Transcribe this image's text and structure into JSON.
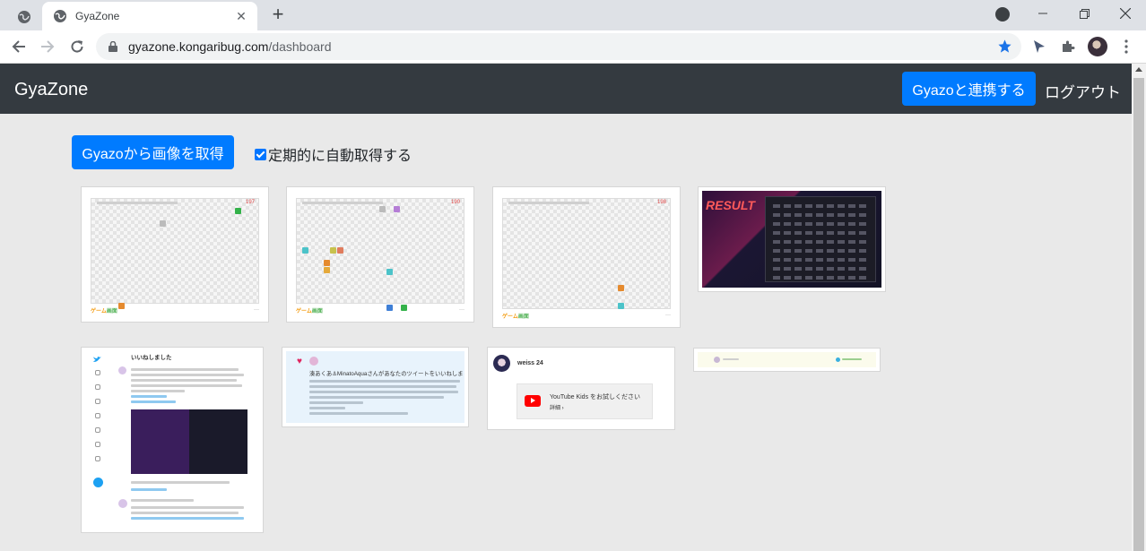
{
  "browser": {
    "tab_title": "GyaZone",
    "url_host": "gyazone.kongaribug.com",
    "url_path": "/dashboard"
  },
  "navbar": {
    "brand": "GyaZone",
    "connect_label": "Gyazoと連携する",
    "logout_label": "ログアウト"
  },
  "controls": {
    "fetch_label": "Gyazoから画像を取得",
    "auto_fetch_label": "定期的に自動取得する",
    "auto_fetch_checked": true
  },
  "thumbnails": [
    {
      "kind": "game",
      "score": "197"
    },
    {
      "kind": "game",
      "score": "190"
    },
    {
      "kind": "game",
      "score": "198"
    },
    {
      "kind": "result",
      "logo": "RESULT"
    },
    {
      "kind": "tweet",
      "title": "いいねしました"
    },
    {
      "kind": "notification",
      "text": "湊あくあ⚓MinatoAquaさんがあなたのツイートをいいねしました"
    },
    {
      "kind": "youtube",
      "user": "weiss 24",
      "title": "YouTube Kids をお試しください",
      "link": "詳細"
    },
    {
      "kind": "strip"
    }
  ],
  "game_footer": {
    "left": "ゲーム",
    "right": "画面"
  },
  "colors": {
    "navbar": "#343a40",
    "primary": "#007bff",
    "page_bg": "#e9e9e9"
  }
}
